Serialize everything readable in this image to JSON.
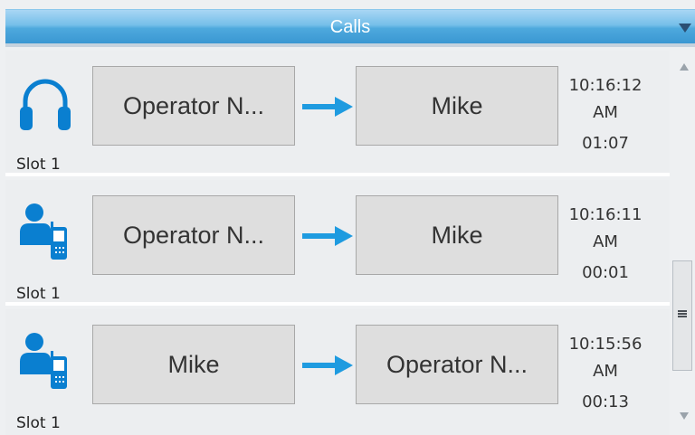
{
  "header": {
    "title": "Calls",
    "menu_icon": "dropdown-triangle-icon"
  },
  "colors": {
    "header_blue": "#4ea9dd",
    "arrow_blue": "#1e9be0",
    "icon_blue": "#0a7fd0"
  },
  "calls": [
    {
      "icon": "headset-icon",
      "slot": "Slot 1",
      "from": "Operator N...",
      "to": "Mike",
      "time": "10:16:12 AM",
      "duration": "01:07"
    },
    {
      "icon": "person-radio-icon",
      "slot": "Slot 1",
      "from": "Operator N...",
      "to": "Mike",
      "time": "10:16:11 AM",
      "duration": "00:01"
    },
    {
      "icon": "person-radio-icon",
      "slot": "Slot 1",
      "from": "Mike",
      "to": "Operator N...",
      "time": "10:15:56 AM",
      "duration": "00:13"
    }
  ]
}
